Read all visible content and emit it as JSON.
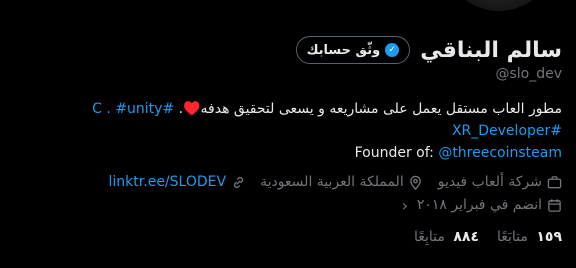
{
  "profile": {
    "name": "سالم البناقي",
    "handle": "@slo_dev",
    "verify_label": "وثّق حسابك"
  },
  "bio": {
    "line1_text": "مطور العاب مستقل يعمل على مشاريعه و يسعى لتحقيق هدفه",
    "line1_heart": "♥️",
    "line1_hash1": "#C .",
    "line1_hash2": "#unity",
    "line1_end": ".",
    "line2_hash": "#XR_Developer",
    "line3_prefix": "Founder of: ",
    "line3_mention": "@threecoinsteam"
  },
  "meta": {
    "category": "شركة ألعاب فيديو",
    "location": "المملكة العربية السعودية",
    "website": "linktr.ee/SLODEV",
    "joined": "انضم في فبراير ٢٠١٨"
  },
  "stats": {
    "following_count": "١٥٩",
    "following_label": "متابَعًا",
    "followers_count": "٨٨٤",
    "followers_label": "متابِعًا"
  },
  "colors": {
    "background": "#000000",
    "text": "#e7e9ea",
    "secondary": "#71767b",
    "link": "#1d9bf0",
    "verified": "#1d9bf0"
  }
}
